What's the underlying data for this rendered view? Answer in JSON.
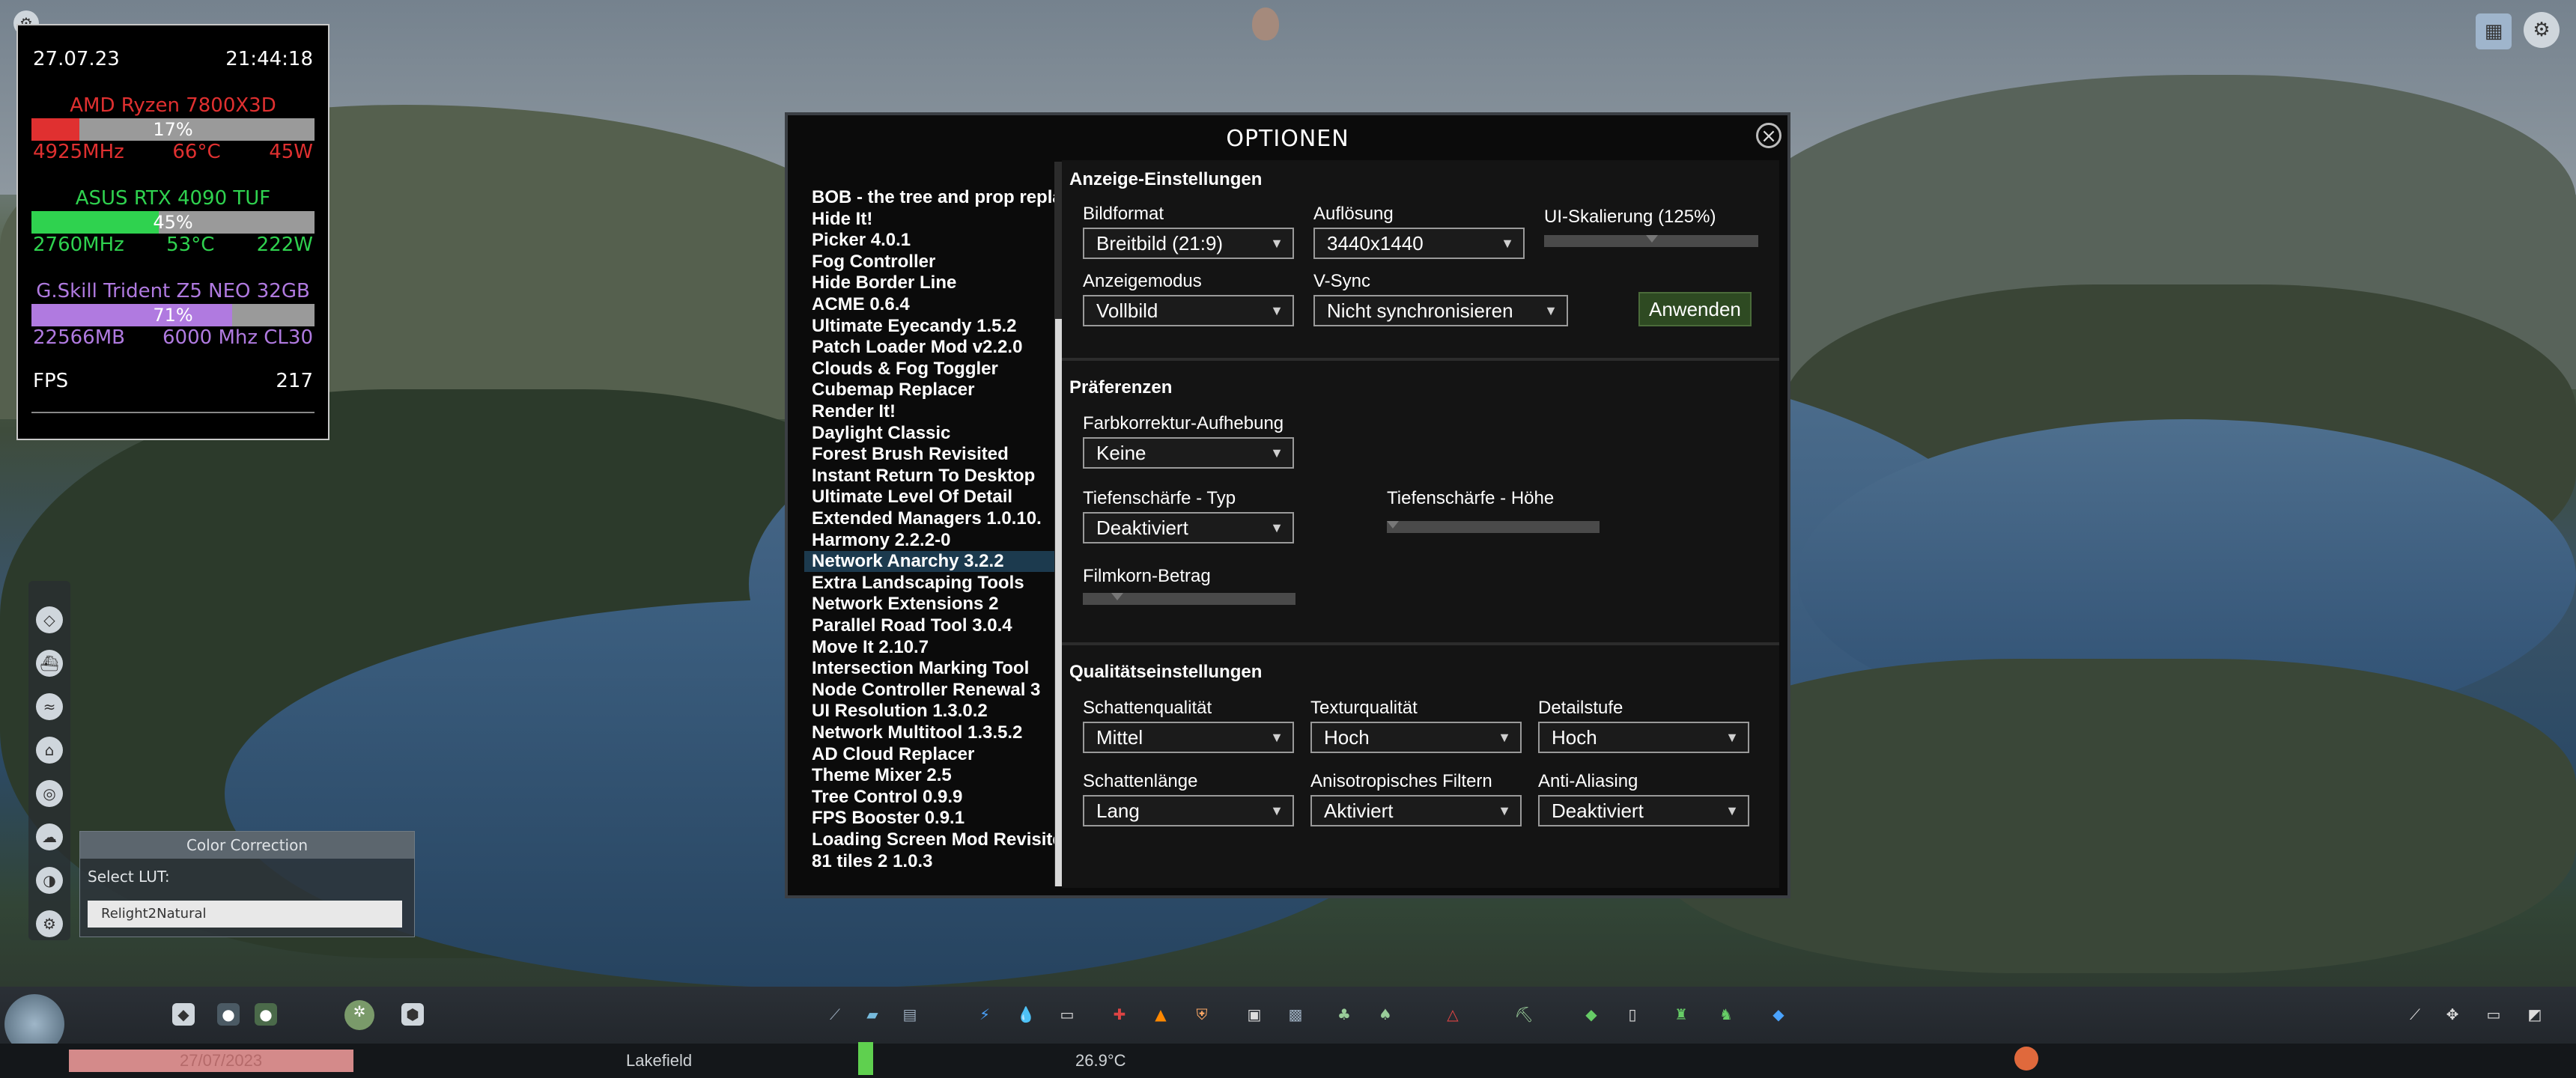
{
  "hud": {
    "date": "27.07.23",
    "time": "21:44:18",
    "cpu": {
      "name": "AMD Ryzen 7800X3D",
      "load_percent": 17,
      "load": "17%",
      "clock": "4925MHz",
      "temp": "66°C",
      "power": "45W"
    },
    "gpu": {
      "name": "ASUS RTX 4090 TUF",
      "load_percent": 45,
      "load": "45%",
      "clock": "2760MHz",
      "temp": "53°C",
      "power": "222W"
    },
    "ram": {
      "name": "G.Skill Trident Z5 NEO 32GB",
      "load_percent": 71,
      "load": "71%",
      "used": "22566MB",
      "speed": "6000 Mhz CL30"
    },
    "fps_label": "FPS",
    "fps": "217",
    "colors": {
      "cpu": "#e03030",
      "gpu": "#2fd24f",
      "ram": "#b07ae0"
    }
  },
  "color_correction": {
    "title": "Color Correction",
    "lut_label": "Select LUT:",
    "lut_value": "Relight2Natural"
  },
  "dialog": {
    "title": "OPTIONEN",
    "mods": [
      "BOB - the tree and prop replacer",
      "Hide It!",
      "Picker 4.0.1",
      "Fog Controller",
      "Hide Border Line",
      "ACME 0.6.4",
      "Ultimate Eyecandy 1.5.2",
      "Patch Loader Mod v2.2.0",
      "Clouds & Fog Toggler",
      "Cubemap Replacer",
      "Render It!",
      "Daylight Classic",
      "Forest Brush Revisited",
      "Instant Return To Desktop",
      "Ultimate Level Of Detail",
      "Extended Managers 1.0.10.",
      "Harmony 2.2.2-0",
      "Network Anarchy 3.2.2",
      "Extra Landscaping Tools",
      "Network Extensions 2",
      "Parallel Road Tool 3.0.4",
      "Move It 2.10.7",
      "Intersection Marking Tool",
      "Node Controller Renewal 3",
      "UI Resolution 1.3.0.2",
      "Network Multitool 1.3.5.2",
      "AD Cloud Replacer",
      "Theme Mixer 2.5",
      "Tree Control 0.9.9",
      "FPS Booster 0.9.1",
      "Loading Screen Mod Revisited",
      "81 tiles 2 1.0.3"
    ],
    "selected_mod": "Network Anarchy 3.2.2",
    "display": {
      "section": "Anzeige-Einstellungen",
      "aspect_label": "Bildformat",
      "aspect_value": "Breitbild (21:9)",
      "resolution_label": "Auflösung",
      "resolution_value": "3440x1440",
      "ui_scale_label": "UI-Skalierung (125%)",
      "mode_label": "Anzeigemodus",
      "mode_value": "Vollbild",
      "vsync_label": "V-Sync",
      "vsync_value": "Nicht synchronisieren",
      "apply_label": "Anwenden"
    },
    "preferences": {
      "section": "Präferenzen",
      "color_corr_label": "Farbkorrektur-Aufhebung",
      "color_corr_value": "Keine",
      "dof_type_label": "Tiefenschärfe - Typ",
      "dof_type_value": "Deaktiviert",
      "dof_height_label": "Tiefenschärfe - Höhe",
      "grain_label": "Filmkorn-Betrag"
    },
    "quality": {
      "section": "Qualitätseinstellungen",
      "shadow_q_label": "Schattenqualität",
      "shadow_q_value": "Mittel",
      "texture_label": "Texturqualität",
      "texture_value": "Hoch",
      "detail_label": "Detailstufe",
      "detail_value": "Hoch",
      "shadow_len_label": "Schattenlänge",
      "shadow_len_value": "Lang",
      "aniso_label": "Anisotropisches Filtern",
      "aniso_value": "Aktiviert",
      "aa_label": "Anti-Aliasing",
      "aa_value": "Deaktiviert"
    }
  },
  "bottom_bar": {
    "date": "27/07/2023",
    "city_name": "Lakefield",
    "temperature": "26.9°C"
  }
}
